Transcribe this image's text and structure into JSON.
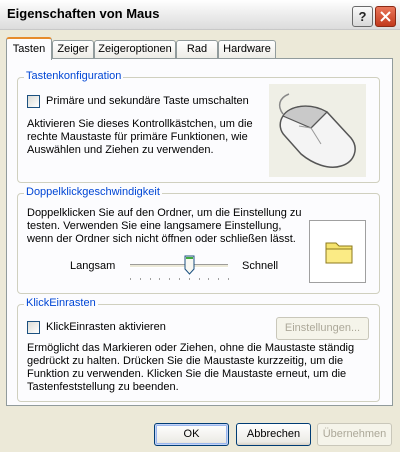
{
  "window": {
    "title": "Eigenschaften von Maus"
  },
  "tabs": [
    {
      "label": "Tasten",
      "active": true
    },
    {
      "label": "Zeiger",
      "active": false
    },
    {
      "label": "Zeigeroptionen",
      "active": false
    },
    {
      "label": "Rad",
      "active": false
    },
    {
      "label": "Hardware",
      "active": false
    }
  ],
  "button_config": {
    "title": "Tastenkonfiguration",
    "checkbox_label": "Primäre und sekundäre Taste umschalten",
    "checked": false,
    "desc_lines": [
      "Aktivieren Sie dieses Kontrollkästchen, um die",
      "rechte Maustaste für primäre Funktionen, wie",
      "Auswählen und Ziehen zu verwenden."
    ]
  },
  "double_click": {
    "title": "Doppelklickgeschwindigkeit",
    "desc_lines": [
      "Doppelklicken Sie auf den Ordner, um die Einstellung zu",
      "testen. Verwenden Sie eine langsamere Einstellung,",
      "wenn der Ordner sich nicht öffnen oder schließen lässt."
    ],
    "slow_label": "Langsam",
    "fast_label": "Schnell",
    "speed_fraction": 0.6
  },
  "click_lock": {
    "title": "KlickEinrasten",
    "checkbox_label": "KlickEinrasten aktivieren",
    "checked": false,
    "settings_button": "Einstellungen...",
    "desc_lines": [
      "Ermöglicht das Markieren oder Ziehen, ohne die Maustaste ständig",
      "gedrückt zu halten. Drücken Sie die Maustaste kurzzeitig, um die",
      "Funktion zu verwenden. Klicken Sie die Maustaste erneut, um die",
      "Tastenfeststellung zu beenden."
    ]
  },
  "footer": {
    "ok": "OK",
    "cancel": "Abbrechen",
    "apply": "Übernehmen"
  },
  "colors": {
    "group_title": "#0046d5",
    "tab_active_accent": "#e68b2c",
    "close_button": "#c2391c"
  }
}
